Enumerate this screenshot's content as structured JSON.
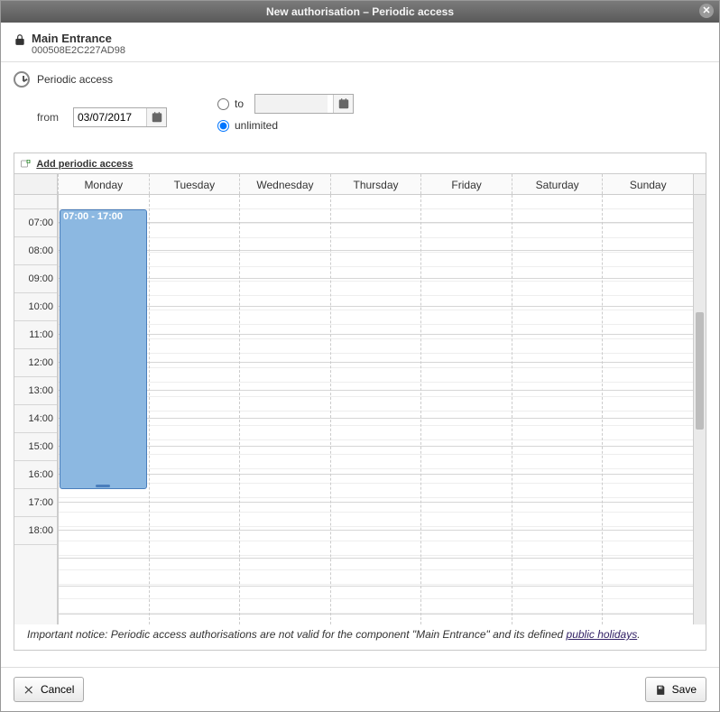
{
  "title": "New authorisation – Periodic access",
  "header": {
    "title": "Main Entrance",
    "subtitle": "000508E2C227AD98"
  },
  "section_label": "Periodic access",
  "from_label": "from",
  "from_value": "03/07/2017",
  "to_label": "to",
  "to_value": "",
  "unlimited_label": "unlimited",
  "duration_mode": "unlimited",
  "add_link": "Add periodic access",
  "days": [
    "Monday",
    "Tuesday",
    "Wednesday",
    "Thursday",
    "Friday",
    "Saturday",
    "Sunday"
  ],
  "hours": [
    "07:00",
    "08:00",
    "09:00",
    "10:00",
    "11:00",
    "12:00",
    "13:00",
    "14:00",
    "15:00",
    "16:00",
    "17:00",
    "18:00"
  ],
  "events": {
    "monday": {
      "label": "07:00 - 17:00",
      "start_row": 0,
      "span_rows": 10
    }
  },
  "notice_prefix": "Important notice: Periodic access authorisations are not valid for the component \"Main Entrance\" and its defined ",
  "notice_link": "public holidays",
  "notice_suffix": ".",
  "buttons": {
    "cancel": "Cancel",
    "save": "Save"
  }
}
